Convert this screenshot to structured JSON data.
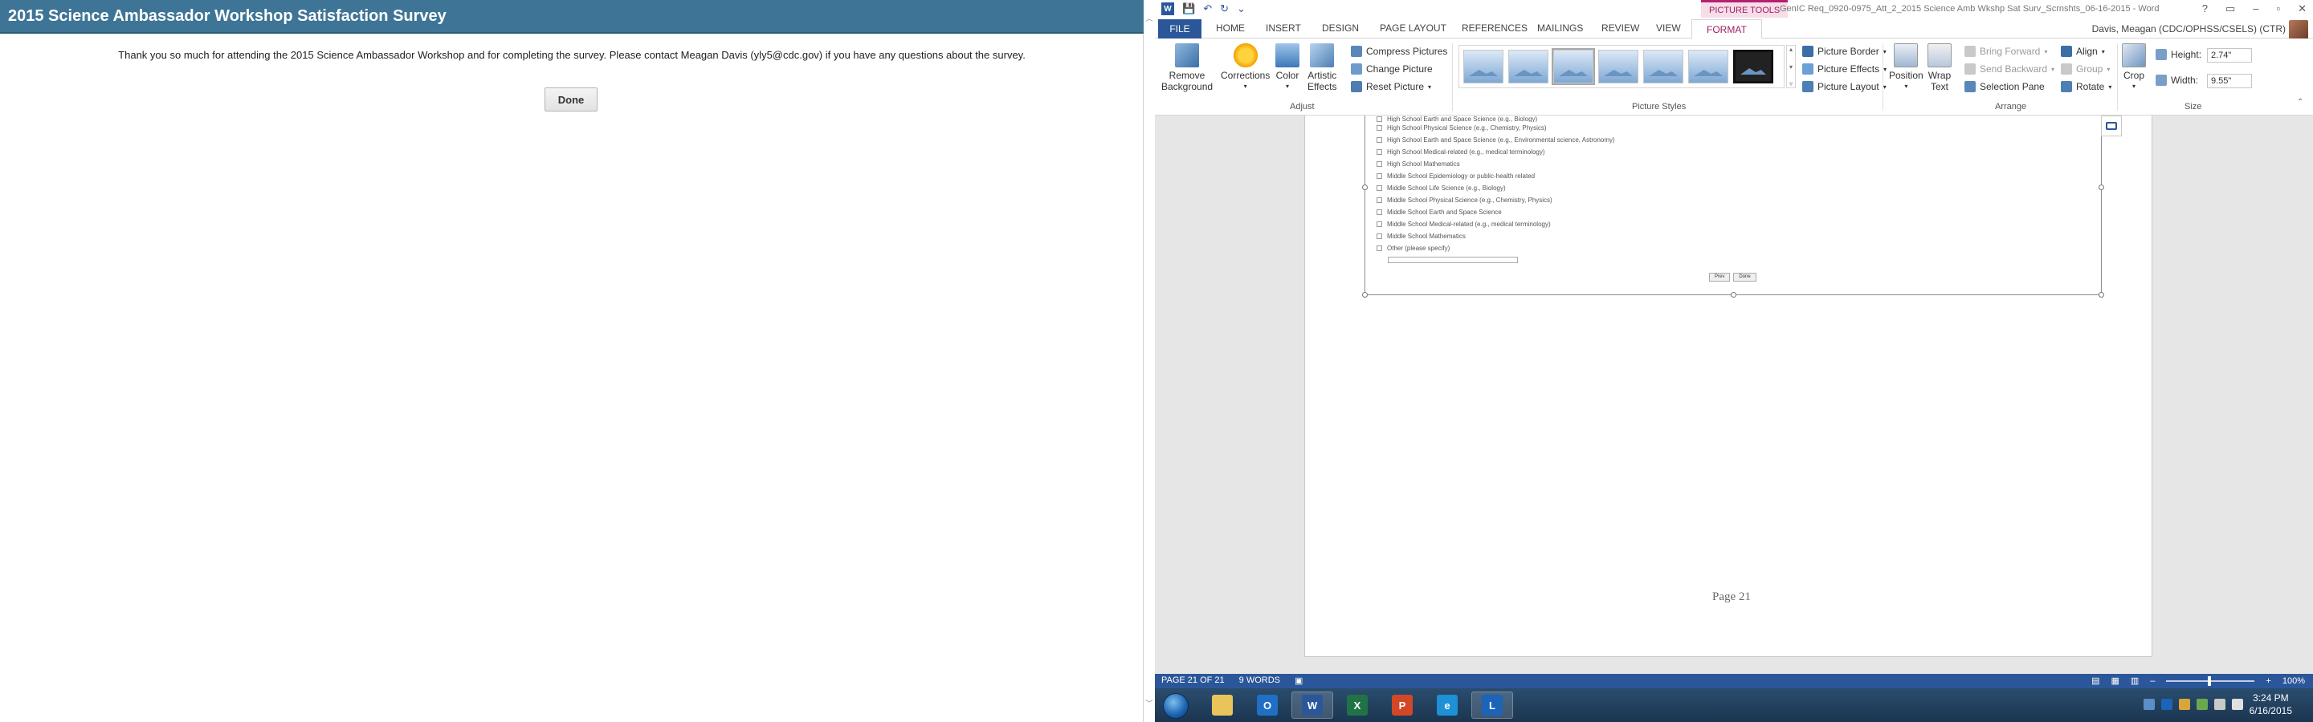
{
  "survey": {
    "title": "2015 Science Ambassador Workshop Satisfaction Survey",
    "message": "Thank you so much for attending the 2015 Science Ambassador Workshop and for completing the survey. Please contact Meagan Davis (yly5@cdc.gov) if you have any questions about the survey.",
    "done_label": "Done"
  },
  "word": {
    "contextual_group": "PICTURE TOOLS",
    "doc_title": "GenIC Req_0920-0975_Att_2_2015 Science Amb Wkshp Sat Surv_Scrnshts_06-16-2015 - Word",
    "window_controls": [
      "?",
      "▭",
      "–",
      "▫",
      "✕"
    ],
    "tabs": {
      "file": "FILE",
      "home": "HOME",
      "insert": "INSERT",
      "design": "DESIGN",
      "page_layout": "PAGE LAYOUT",
      "references": "REFERENCES",
      "mailings": "MAILINGS",
      "review": "REVIEW",
      "view": "VIEW",
      "format": "FORMAT"
    },
    "user": "Davis, Meagan (CDC/OPHSS/CSELS) (CTR)",
    "ribbon": {
      "remove_background_1": "Remove",
      "remove_background_2": "Background",
      "corrections": "Corrections",
      "color": "Color",
      "artistic_effects_1": "Artistic",
      "artistic_effects_2": "Effects",
      "compress_pictures": "Compress Pictures",
      "change_picture": "Change Picture",
      "reset_picture": "Reset Picture",
      "adjust_label": "Adjust",
      "picture_border": "Picture Border",
      "picture_effects": "Picture Effects",
      "picture_layout": "Picture Layout",
      "picture_styles_label": "Picture Styles",
      "position": "Position",
      "wrap_text_1": "Wrap",
      "wrap_text_2": "Text",
      "bring_forward": "Bring Forward",
      "send_backward": "Send Backward",
      "selection_pane": "Selection Pane",
      "align": "Align",
      "group": "Group",
      "rotate": "Rotate",
      "arrange_label": "Arrange",
      "crop": "Crop",
      "height_label": "Height:",
      "height_value": "2.74\"",
      "width_label": "Width:",
      "width_value": "9.55\"",
      "size_label": "Size"
    },
    "document": {
      "checkbox_items": [
        "High School Earth and Space Science (e.g., Biology)",
        "High School Physical Science (e.g., Chemistry, Physics)",
        "High School Earth and Space Science (e.g., Environmental science, Astronomy)",
        "High School Medical-related (e.g., medical terminology)",
        "High School Mathematics",
        "Middle School Epidemiology or public-health related",
        "Middle School Life Science (e.g., Biology)",
        "Middle School Physical Science (e.g., Chemistry, Physics)",
        "Middle School Earth and Space Science",
        "Middle School Medical-related (e.g., medical terminology)",
        "Middle School Mathematics",
        "Other (please specify)"
      ],
      "prev_label": "Prev",
      "done_label": "Done",
      "page_label": "Page 21"
    },
    "status": {
      "page": "PAGE 21 OF 21",
      "words": "9 WORDS",
      "zoom": "100%"
    }
  },
  "taskbar": {
    "time": "3:24 PM",
    "date": "6/16/2015"
  }
}
